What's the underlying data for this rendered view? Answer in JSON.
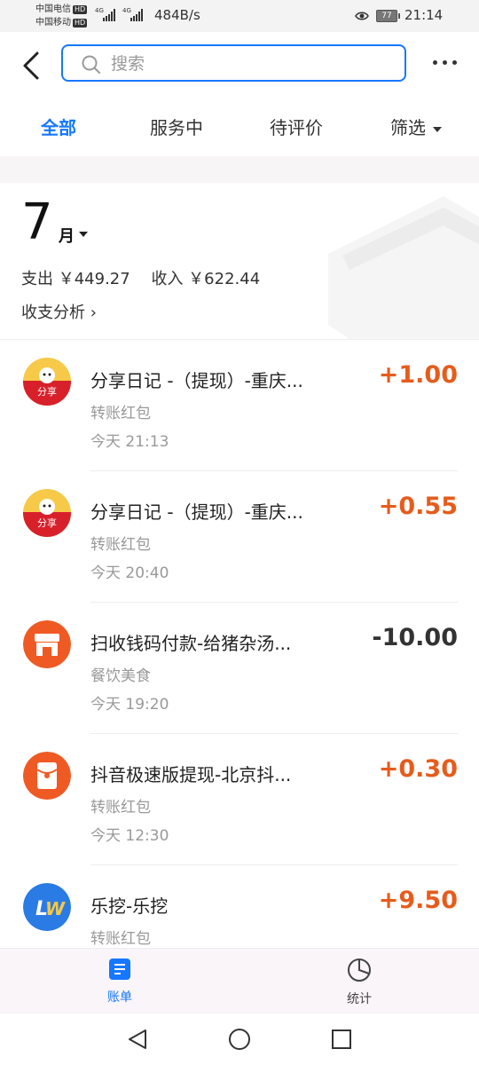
{
  "status_bar": {
    "carrier1": "中国电信",
    "carrier2": "中国移动",
    "hd_label": "HD",
    "net1": "4G",
    "net2": "4G",
    "speed": "484B/s",
    "battery": "77",
    "time": "21:14"
  },
  "header": {
    "search_placeholder": "搜索"
  },
  "tabs": {
    "all": "全部",
    "in_service": "服务中",
    "pending_review": "待评价",
    "filter": "筛选"
  },
  "summary": {
    "month_number": "7",
    "month_unit": "月",
    "expense": "支出 ￥449.27",
    "income": "收入 ￥622.44",
    "analysis_label": "收支分析 ›"
  },
  "transactions": [
    {
      "title": "分享日记 -（提现）-重庆...",
      "category": "转账红包",
      "time": "今天  21:13",
      "amount": "+1.00",
      "sign": "pos",
      "icon": "share-diary-icon"
    },
    {
      "title": "分享日记 -（提现）-重庆...",
      "category": "转账红包",
      "time": "今天  20:40",
      "amount": "+0.55",
      "sign": "pos",
      "icon": "share-diary-icon"
    },
    {
      "title": "扫收钱码付款-给猪杂汤...",
      "category": "餐饮美食",
      "time": "今天  19:20",
      "amount": "-10.00",
      "sign": "neg",
      "icon": "shop-icon"
    },
    {
      "title": "抖音极速版提现-北京抖...",
      "category": "转账红包",
      "time": "今天  12:30",
      "amount": "+0.30",
      "sign": "pos",
      "icon": "red-envelope-icon"
    },
    {
      "title": "乐挖-乐挖",
      "category": "转账红包",
      "time": "",
      "amount": "+9.50",
      "sign": "pos",
      "icon": "lewa-logo-icon"
    }
  ],
  "bottom_nav": {
    "bills": "账单",
    "stats": "统计"
  },
  "colors": {
    "accent": "#1677ff",
    "income": "#e65c1c",
    "expense": "#333333"
  }
}
